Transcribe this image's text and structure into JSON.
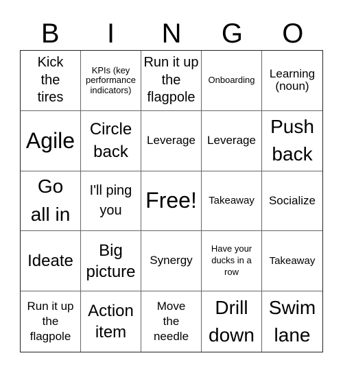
{
  "header": [
    "B",
    "I",
    "N",
    "G",
    "O"
  ],
  "cells": [
    "Kick the tires",
    "KPIs (key performance indicators)",
    "Run it up the flagpole",
    "Onboarding",
    "Learning (noun)",
    "Agile",
    "Circle back",
    "Leverage",
    "Leverage",
    "Push back",
    "Go all in",
    "I'll ping you",
    "Free!",
    "Takeaway",
    "Socialize",
    "Ideate",
    "Big picture",
    "Synergy",
    "Have your ducks in a row",
    "Takeaway",
    "Run it up the flagpole",
    "Action item",
    "Move the needle",
    "Drill down",
    "Swim lane"
  ]
}
